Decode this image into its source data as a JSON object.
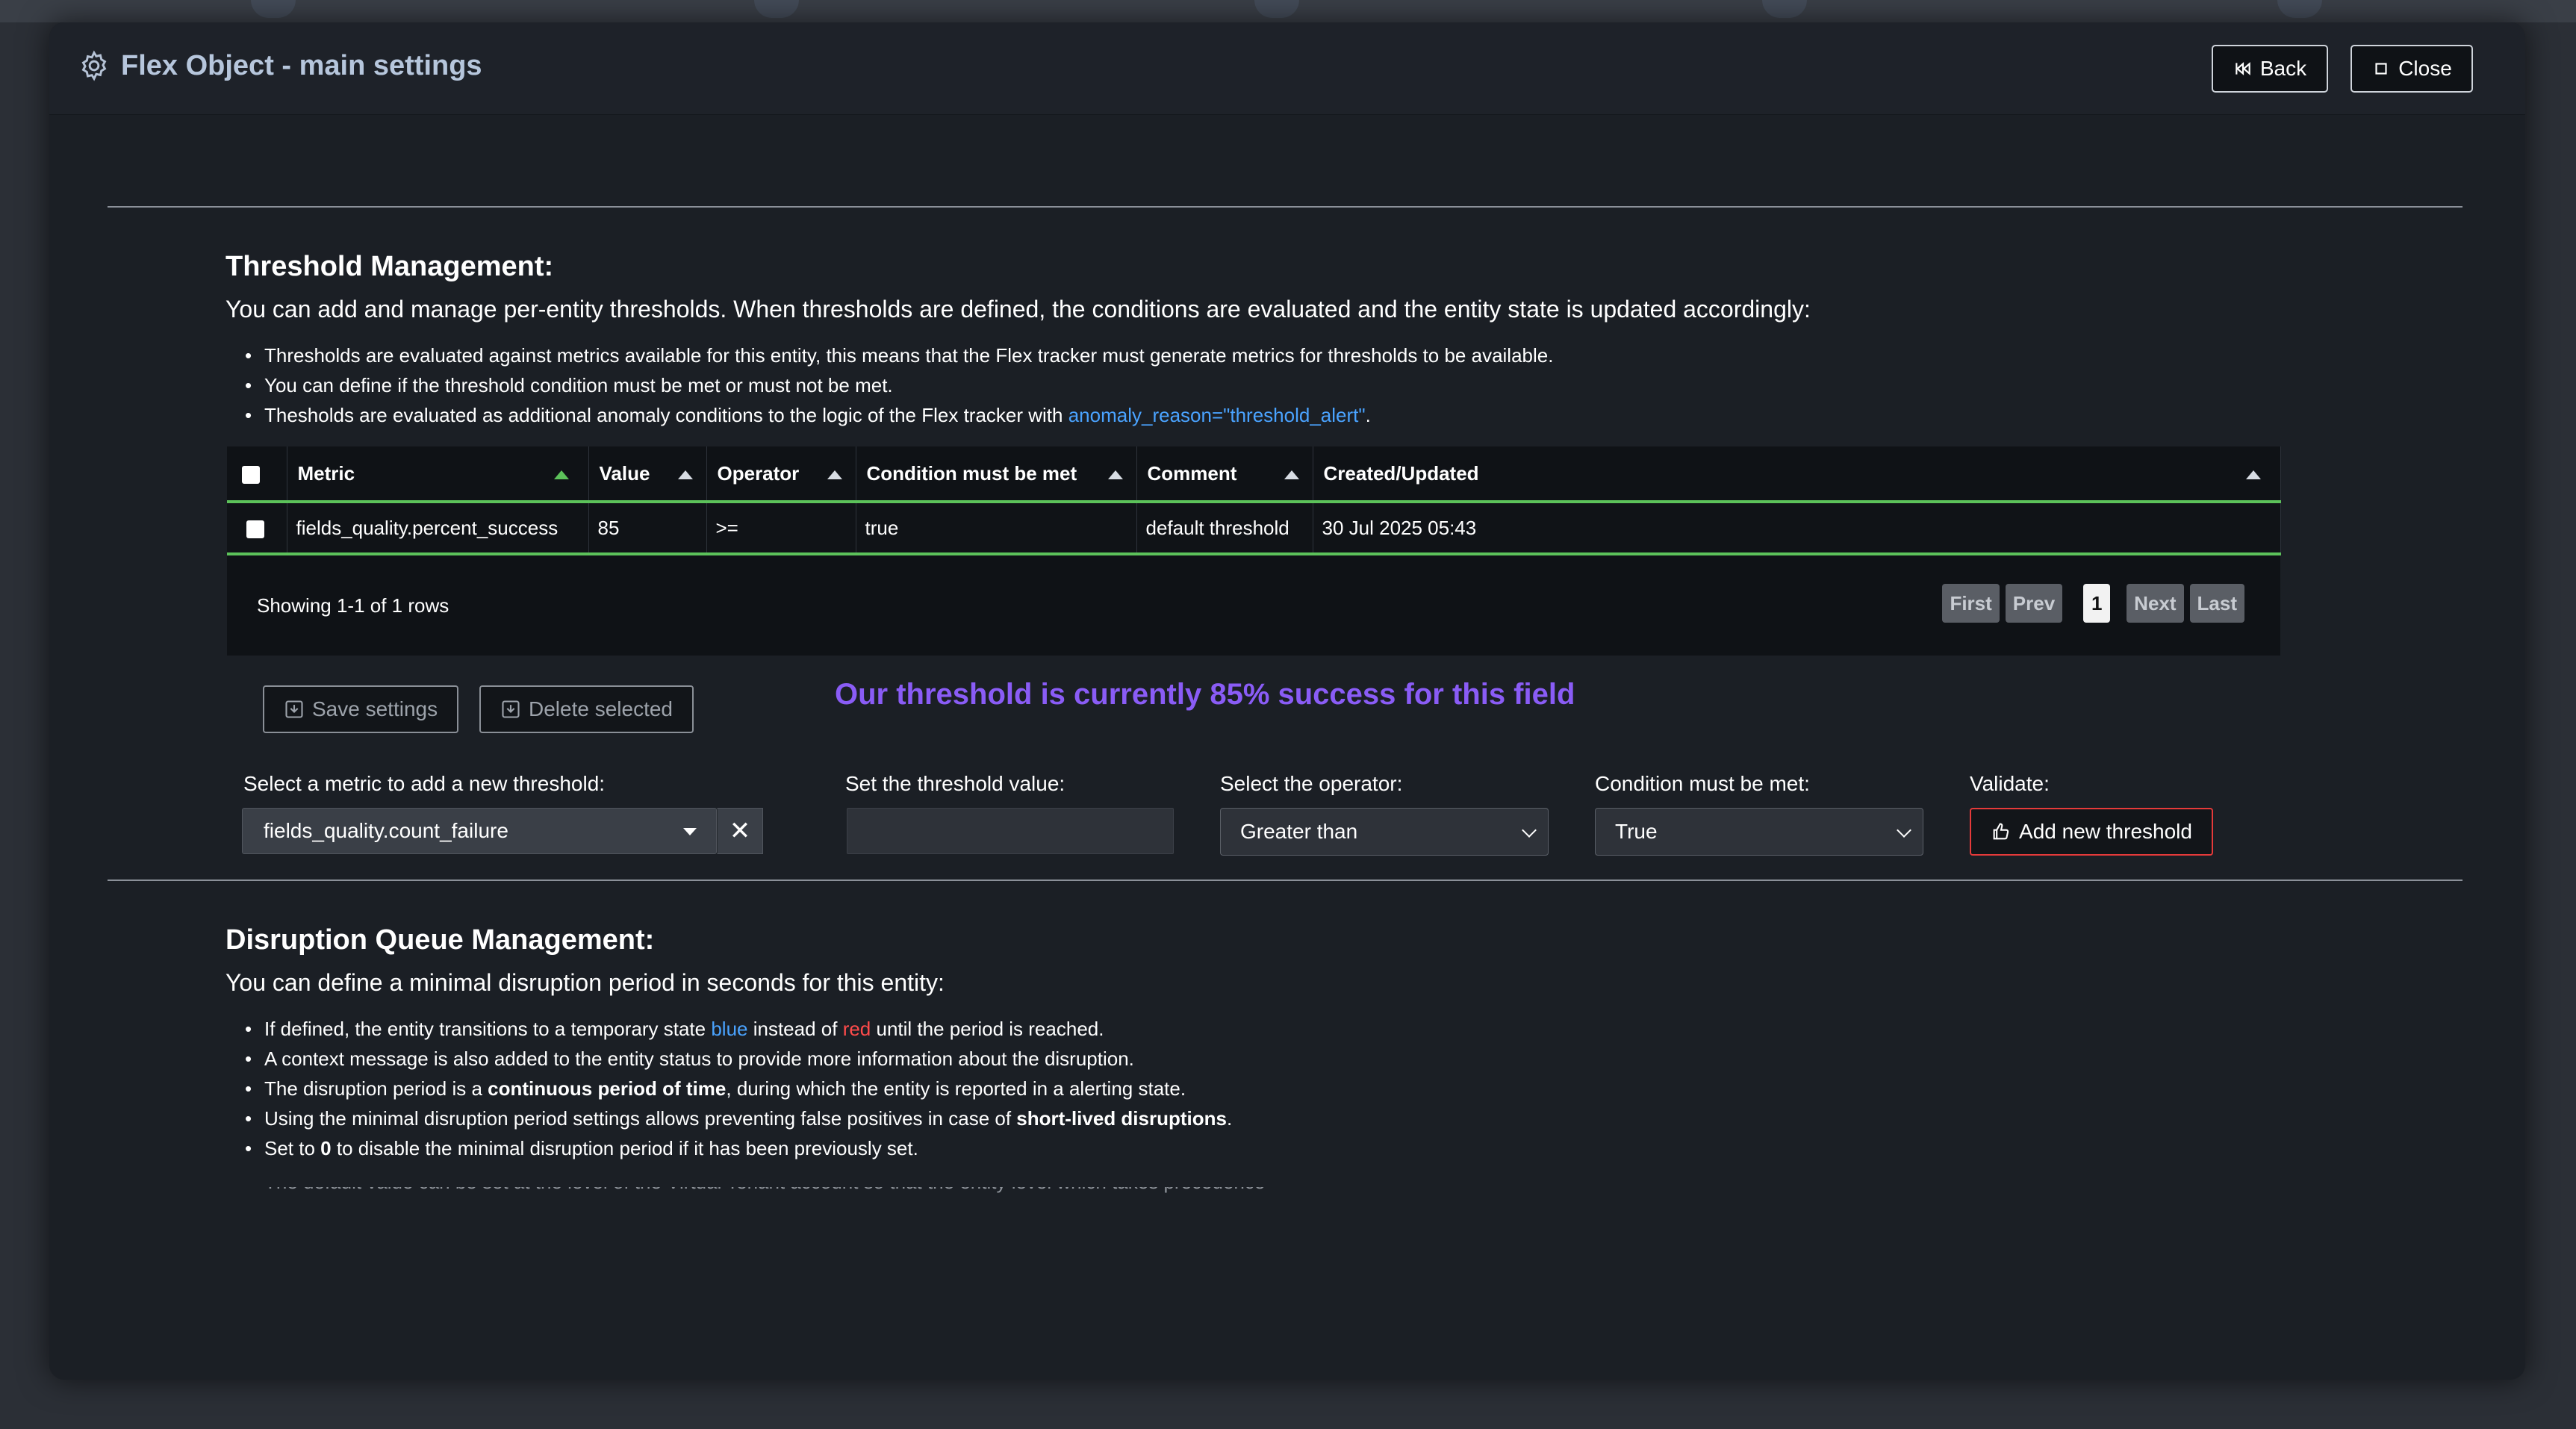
{
  "modal": {
    "title": "Flex Object - main settings",
    "back_label": "Back",
    "close_label": "Close"
  },
  "threshold": {
    "title": "Threshold Management:",
    "description": "You can add and manage per-entity thresholds. When thresholds are defined, the conditions are evaluated and the entity state is updated accordingly:",
    "bullets": [
      "Thresholds are evaluated against metrics available for this entity, this means that the Flex tracker must generate metrics for thresholds to be available.",
      "You can define if the threshold condition must be met or must not be met."
    ],
    "bullet3_prefix": "Thesholds are evaluated as additional anomaly conditions to the logic of the Flex tracker with ",
    "bullet3_link": "anomaly_reason=\"threshold_alert\"",
    "bullet3_suffix": ".",
    "table": {
      "columns": [
        "Metric",
        "Value",
        "Operator",
        "Condition must be met",
        "Comment",
        "Created/Updated"
      ],
      "rows": [
        {
          "metric": "fields_quality.percent_success",
          "value": "85",
          "operator": ">=",
          "condition": "true",
          "comment": "default threshold",
          "created": "30 Jul 2025 05:43"
        }
      ],
      "rows_info": "Showing 1-1 of 1 rows",
      "pager": {
        "first": "First",
        "prev": "Prev",
        "page": "1",
        "next": "Next",
        "last": "Last"
      }
    },
    "save_label": "Save settings",
    "delete_label": "Delete selected",
    "highlight": "Our threshold is currently 85% success for this field",
    "form": {
      "metric_label": "Select a metric to add a new threshold:",
      "metric_value": "fields_quality.count_failure",
      "value_label": "Set the threshold value:",
      "value_input": "",
      "operator_label": "Select the operator:",
      "operator_value": "Greater than",
      "condition_label": "Condition must be met:",
      "condition_value": "True",
      "validate_label": "Validate:",
      "add_label": "Add new threshold"
    }
  },
  "disruption": {
    "title": "Disruption Queue Management:",
    "description": "You can define a minimal disruption period in seconds for this entity:",
    "b1_a": "If defined, the entity transitions to a temporary state ",
    "b1_blue": "blue",
    "b1_b": " instead of ",
    "b1_red": "red",
    "b1_c": " until the period is reached.",
    "b2": "A context message is also added to the entity status to provide more information about the disruption.",
    "b3_a": "The disruption period is a ",
    "b3_bold": "continuous period of time",
    "b3_b": ", during which the entity is reported in a alerting state.",
    "b4_a": "Using the minimal disruption period settings allows preventing false positives in case of ",
    "b4_bold": "short-lived disruptions",
    "b4_b": ".",
    "b5_a": "Set to ",
    "b5_bold": "0",
    "b5_b": " to disable the minimal disruption period if it has been previously set.",
    "b6_partial": "The default value can be set at the level of the Virtual Tenant account so that the entity level which takes precedence"
  },
  "colors": {
    "accent_purple": "#8a5cf6",
    "table_border_green": "#5cc25a",
    "add_button_border": "#e53a3a",
    "link_blue": "#4aa3ff"
  }
}
